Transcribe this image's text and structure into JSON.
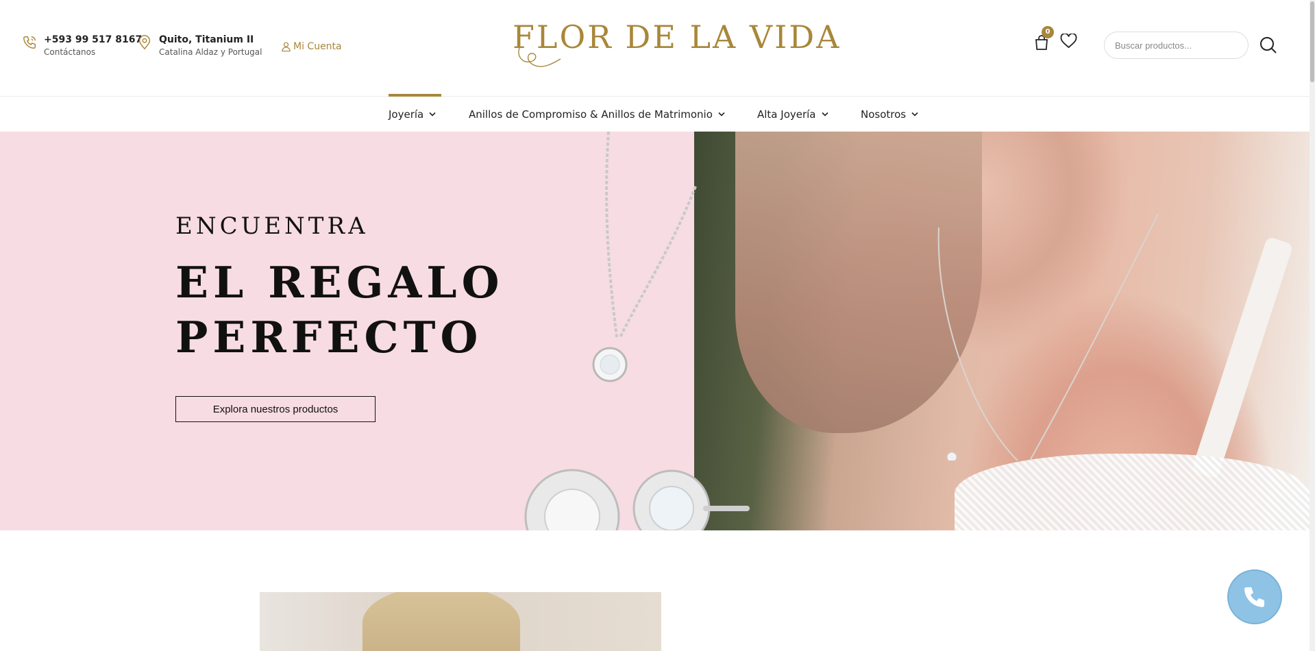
{
  "header": {
    "phone": {
      "number": "+593 99 517 8167",
      "label": "Contáctanos",
      "icon": "phone-icon"
    },
    "location": {
      "name": "Quito, Titanium II",
      "address": "Catalina Aldaz y Portugal",
      "icon": "map-pin-icon"
    },
    "account": {
      "label": "Mi Cuenta",
      "icon": "user-icon"
    },
    "logo": {
      "text": "FLOR DE LA VIDA"
    },
    "cart": {
      "count": "0",
      "icon": "shopping-bag-icon"
    },
    "wishlist": {
      "icon": "heart-icon"
    },
    "search": {
      "placeholder": "Buscar productos...",
      "icon": "search-icon"
    }
  },
  "nav": {
    "items": [
      {
        "label": "Joyería",
        "active": true
      },
      {
        "label": "Anillos de Compromiso & Anillos de Matrimonio",
        "active": false
      },
      {
        "label": "Alta Joyería",
        "active": false
      },
      {
        "label": "Nosotros",
        "active": false
      }
    ]
  },
  "hero": {
    "subtitle": "ENCUENTRA",
    "title": "EL REGALO PERFECTO",
    "button_label": "Explora nuestros productos"
  },
  "floating": {
    "icon": "phone-call-icon"
  },
  "colors": {
    "brand_gold": "#a8873a",
    "hero_pink": "#f7dce3",
    "call_button": "#8ec3e6"
  }
}
